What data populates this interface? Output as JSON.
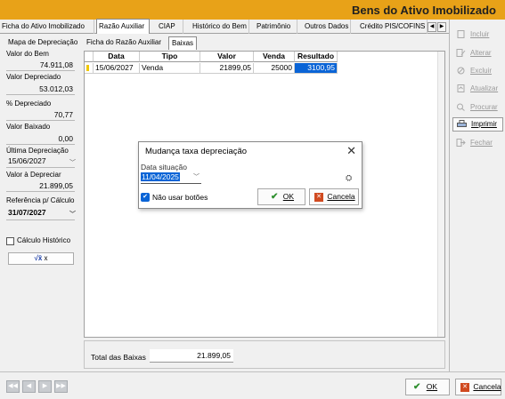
{
  "window": {
    "title": "Bens do Ativo Imobilizado"
  },
  "tabs": [
    {
      "label": "Ficha do Ativo Imobilizado"
    },
    {
      "label": "Razão Auxiliar"
    },
    {
      "label": "CIAP"
    },
    {
      "label": "Histórico do Bem"
    },
    {
      "label": "Patrimônio"
    },
    {
      "label": "Outros Dados"
    },
    {
      "label": "Crédito PIS/COFINS"
    }
  ],
  "left_panel": {
    "mapa": "Mapa de Depreciação",
    "valor_do_bem_label": "Valor do Bem",
    "valor_do_bem": "74.911,08",
    "valor_depreciado_label": "Valor Depreciado",
    "valor_depreciado": "53.012,03",
    "pct_depreciado_label": "% Depreciado",
    "pct_depreciado": "70,77",
    "valor_baixado_label": "Valor Baixado",
    "valor_baixado": "0,00",
    "ultima_depreciacao_label": "Última Depreciação",
    "ultima_depreciacao": "15/06/2027",
    "valor_a_depreciar_label": "Valor à Depreciar",
    "valor_a_depreciar": "21.899,05",
    "referencia_label": "Referência p/ Cálculo",
    "referencia": "31/07/2027",
    "calculo_historico": "Cálculo Histórico",
    "calc_button": "x"
  },
  "subtabs": [
    {
      "label": "Ficha do Razão Auxiliar"
    },
    {
      "label": "Baixas"
    }
  ],
  "grid": {
    "columns": [
      "Data",
      "Tipo",
      "Valor",
      "Venda",
      "Resultado"
    ],
    "rows": [
      {
        "data": "15/06/2027",
        "tipo": "Venda",
        "valor": "21899,05",
        "venda": "25000",
        "resultado": "3100,95"
      }
    ]
  },
  "footer": {
    "total_label": "Total das Baixas",
    "total_value": "21.899,05"
  },
  "right_panel": {
    "incluir": "Incluir",
    "alterar": "Alterar",
    "excluir": "Excluir",
    "atualizar": "Atualizar",
    "procurar": "Procurar",
    "imprimir": "Imprimir",
    "fechar": "Fechar"
  },
  "bottom": {
    "ok": "OK",
    "cancela": "Cancela"
  },
  "dialog": {
    "title": "Mudança taxa depreciação",
    "date_label": "Data situação",
    "date_value": "11/04/2025",
    "checkbox_label": "Não usar botões",
    "ok": "OK",
    "cancela": "Cancela"
  },
  "colors": {
    "title_bar": "#e8a218",
    "selection": "#0a64d6",
    "ok_green": "#2f8f2f",
    "cancel_red": "#d04a20"
  }
}
